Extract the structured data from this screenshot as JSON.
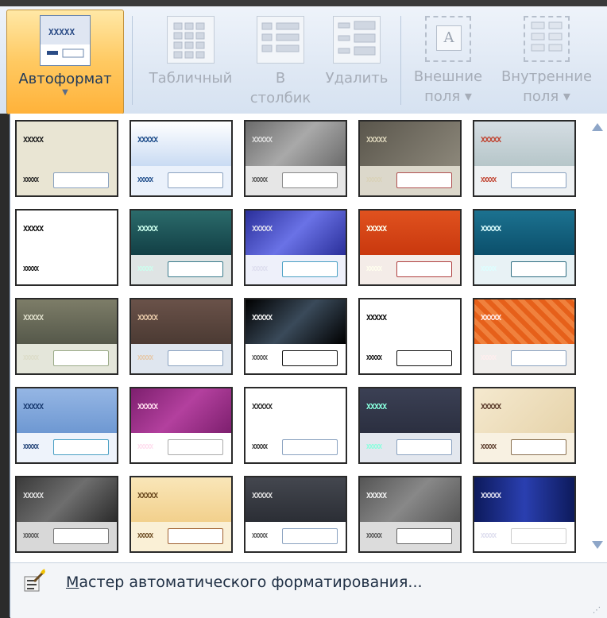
{
  "ribbon": {
    "autoformat_label": "Автоформат",
    "tabular_label": "Табличный",
    "column_label_1": "В",
    "column_label_2": "столбик",
    "delete_label": "Удалить",
    "outer_label_1": "Внешние",
    "outer_label_2": "поля ▾",
    "inner_label_1": "Внутренние",
    "inner_label_2": "поля ▾",
    "outer_icon_letter": "A"
  },
  "gallery": {
    "checker_text": "XXXXX",
    "styles": [
      {
        "name": "style-1",
        "hd": "#e9e5d3",
        "hdText": "#222",
        "ft": "#e9e5d3",
        "box": "#8aa2c0"
      },
      {
        "name": "style-2",
        "hd": "linear-gradient(#ffffff,#c9dbf3)",
        "hdText": "#1d4c8a",
        "ft": "#eaf1fb",
        "box": "#8aa2c0"
      },
      {
        "name": "style-3",
        "hd": "linear-gradient(135deg,#6b6b6b,#a9a9a9,#6b6b6b)",
        "hdText": "#ddd",
        "ft": "#e6e6e6",
        "box": "#888"
      },
      {
        "name": "style-4",
        "hd": "linear-gradient(135deg,#5a564c,#8c877a)",
        "hdText": "#d9d2b8",
        "ft": "#dcd8cb",
        "box": "#b05050"
      },
      {
        "name": "style-5",
        "hd": "linear-gradient(#d5dde3,#b6c6c9)",
        "hdText": "#c0412e",
        "ft": "#eef1f3",
        "box": "#8aa2c0"
      },
      {
        "name": "style-6",
        "hd": "#ffffff",
        "hdText": "#111",
        "ft": "#ffffff",
        "box": "#ffffff"
      },
      {
        "name": "style-7",
        "hd": "linear-gradient(#2b6b6b,#123f45)",
        "hdText": "#cfe",
        "ft": "#dfe4e4",
        "box": "#3a7c8c"
      },
      {
        "name": "style-8",
        "hd": "linear-gradient(135deg,#2a2f9a,#6a72e6,#2a2f9a)",
        "hdText": "#dde",
        "ft": "#eef0fa",
        "box": "#4aa0c4"
      },
      {
        "name": "style-9",
        "hd": "linear-gradient(#e0521f,#c9380e)",
        "hdText": "#ffe",
        "ft": "#f4ece8",
        "box": "#b04040"
      },
      {
        "name": "style-10",
        "hd": "linear-gradient(#1c7290,#0b4f6b)",
        "hdText": "#dff",
        "ft": "#e8f2f5",
        "box": "#2f6e82"
      },
      {
        "name": "style-11",
        "hd": "linear-gradient(#7d7d68,#55584a)",
        "hdText": "#dcdcc8",
        "ft": "#e4e6da",
        "box": "#9aaa88"
      },
      {
        "name": "style-12",
        "hd": "linear-gradient(#6a5249,#4b3a33)",
        "hdText": "#e6c8a8",
        "ft": "#dfe6ef",
        "box": "#8aa2c0"
      },
      {
        "name": "style-13",
        "hd": "linear-gradient(135deg,#000,#3a4a5a,#000)",
        "hdText": "#eee",
        "ft": "#ffffff",
        "box": "#111"
      },
      {
        "name": "style-14",
        "hd": "#ffffff",
        "hdText": "#111",
        "ft": "#ffffff",
        "box": "#111"
      },
      {
        "name": "style-15",
        "hd": "repeating-linear-gradient(45deg,#e6601a,#e6601a 6px,#f0813d 6px,#f0813d 12px)",
        "hdText": "#fee",
        "ft": "#f0eeec",
        "box": "#8aa2c0"
      },
      {
        "name": "style-16",
        "hd": "linear-gradient(#95b6e4,#6e98d2)",
        "hdText": "#1d3f75",
        "ft": "#eef3fb",
        "box": "#4aa0c4"
      },
      {
        "name": "style-17",
        "hd": "linear-gradient(135deg,#7d1f6e,#b3409e,#7d1f6e)",
        "hdText": "#fde",
        "ft": "#ffffff",
        "box": "#aaa"
      },
      {
        "name": "style-18",
        "hd": "#ffffff",
        "hdText": "#333",
        "ft": "#ffffff",
        "box": "#8aa2c0"
      },
      {
        "name": "style-19",
        "hd": "linear-gradient(#3b4054,#2b2f40)",
        "hdText": "#8fd",
        "ft": "#e3e7ee",
        "box": "#8aa2c0"
      },
      {
        "name": "style-20",
        "hd": "linear-gradient(135deg,#f5e9cf,#e6d3aa)",
        "hdText": "#5a3a2a",
        "ft": "#f8f1e2",
        "box": "#8a7050"
      },
      {
        "name": "style-21",
        "hd": "linear-gradient(135deg,#3a3a3a,#6e6e6e,#2a2a2a)",
        "hdText": "#ddd",
        "ft": "#d8d8d8",
        "box": "#777"
      },
      {
        "name": "style-22",
        "hd": "linear-gradient(#f9e6b8,#f2d08c)",
        "hdText": "#6b4a20",
        "ft": "#faf0d6",
        "box": "#a06030"
      },
      {
        "name": "style-23",
        "hd": "linear-gradient(#44474f,#2b2e35)",
        "hdText": "#ddd",
        "ft": "#ffffff",
        "box": "#8aa2c0"
      },
      {
        "name": "style-24",
        "hd": "linear-gradient(135deg,#555,#888,#555)",
        "hdText": "#eee",
        "ft": "#dcdcdc",
        "box": "#666"
      },
      {
        "name": "style-25",
        "hd": "linear-gradient(90deg,#0d1a5c,#2a3fb0,#0d1a5c)",
        "hdText": "#dde",
        "ft": "#ffffff",
        "box": "#cccccc"
      }
    ]
  },
  "footer": {
    "wizard_underlined": "М",
    "wizard_rest": "астер автоматического форматирования...",
    "grip": "⋰"
  }
}
